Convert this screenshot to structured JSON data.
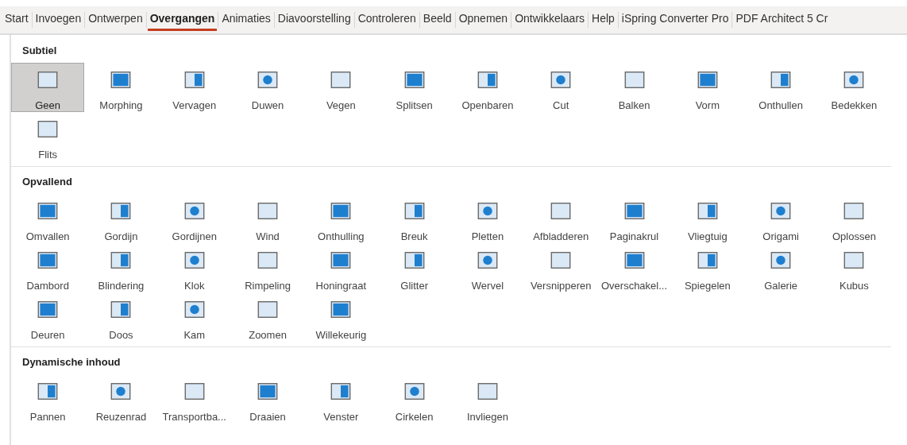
{
  "tabs": [
    {
      "label": "Start",
      "selected": false
    },
    {
      "label": "Invoegen",
      "selected": false
    },
    {
      "label": "Ontwerpen",
      "selected": false
    },
    {
      "label": "Overgangen",
      "selected": true
    },
    {
      "label": "Animaties",
      "selected": false
    },
    {
      "label": "Diavoorstelling",
      "selected": false
    },
    {
      "label": "Controleren",
      "selected": false
    },
    {
      "label": "Beeld",
      "selected": false
    },
    {
      "label": "Opnemen",
      "selected": false
    },
    {
      "label": "Ontwikkelaars",
      "selected": false
    },
    {
      "label": "Help",
      "selected": false
    },
    {
      "label": "iSpring Converter Pro",
      "selected": false
    },
    {
      "label": "PDF Architect 5 Cr",
      "selected": false
    }
  ],
  "sections": [
    {
      "title": "Subtiel",
      "items": [
        {
          "label": "Geen",
          "selected": true
        },
        {
          "label": "Morphing",
          "selected": false
        },
        {
          "label": "Vervagen",
          "selected": false
        },
        {
          "label": "Duwen",
          "selected": false
        },
        {
          "label": "Vegen",
          "selected": false
        },
        {
          "label": "Splitsen",
          "selected": false
        },
        {
          "label": "Openbaren",
          "selected": false
        },
        {
          "label": "Cut",
          "selected": false
        },
        {
          "label": "Balken",
          "selected": false
        },
        {
          "label": "Vorm",
          "selected": false
        },
        {
          "label": "Onthullen",
          "selected": false
        },
        {
          "label": "Bedekken",
          "selected": false
        },
        {
          "label": "Flits",
          "selected": false
        }
      ]
    },
    {
      "title": "Opvallend",
      "items": [
        {
          "label": "Omvallen",
          "selected": false
        },
        {
          "label": "Gordijn",
          "selected": false
        },
        {
          "label": "Gordijnen",
          "selected": false
        },
        {
          "label": "Wind",
          "selected": false
        },
        {
          "label": "Onthulling",
          "selected": false
        },
        {
          "label": "Breuk",
          "selected": false
        },
        {
          "label": "Pletten",
          "selected": false
        },
        {
          "label": "Afbladderen",
          "selected": false
        },
        {
          "label": "Paginakrul",
          "selected": false
        },
        {
          "label": "Vliegtuig",
          "selected": false
        },
        {
          "label": "Origami",
          "selected": false
        },
        {
          "label": "Oplossen",
          "selected": false
        },
        {
          "label": "Dambord",
          "selected": false
        },
        {
          "label": "Blindering",
          "selected": false
        },
        {
          "label": "Klok",
          "selected": false
        },
        {
          "label": "Rimpeling",
          "selected": false
        },
        {
          "label": "Honingraat",
          "selected": false
        },
        {
          "label": "Glitter",
          "selected": false
        },
        {
          "label": "Wervel",
          "selected": false
        },
        {
          "label": "Versnipperen",
          "selected": false
        },
        {
          "label": "Overschakel...",
          "selected": false
        },
        {
          "label": "Spiegelen",
          "selected": false
        },
        {
          "label": "Galerie",
          "selected": false
        },
        {
          "label": "Kubus",
          "selected": false
        },
        {
          "label": "Deuren",
          "selected": false
        },
        {
          "label": "Doos",
          "selected": false
        },
        {
          "label": "Kam",
          "selected": false
        },
        {
          "label": "Zoomen",
          "selected": false
        },
        {
          "label": "Willekeurig",
          "selected": false
        }
      ]
    },
    {
      "title": "Dynamische inhoud",
      "items": [
        {
          "label": "Pannen",
          "selected": false
        },
        {
          "label": "Reuzenrad",
          "selected": false
        },
        {
          "label": "Transportba...",
          "selected": false
        },
        {
          "label": "Draaien",
          "selected": false
        },
        {
          "label": "Venster",
          "selected": false
        },
        {
          "label": "Cirkelen",
          "selected": false
        },
        {
          "label": "Invliegen",
          "selected": false
        }
      ]
    }
  ]
}
